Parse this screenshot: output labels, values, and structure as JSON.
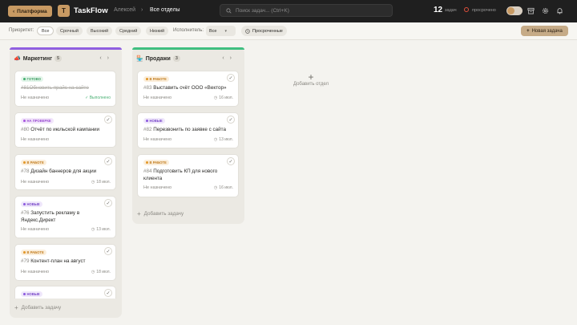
{
  "topbar": {
    "platform_label": "Платформа",
    "logo_letter": "T",
    "app_title": "TaskFlow",
    "user": "Алексей",
    "separator": "›",
    "current_view": "Все отделы",
    "search_placeholder": "Поиск задач... (Ctrl+K)",
    "tasks_count": "12",
    "tasks_label": "задач",
    "overdue_label": "просрочено"
  },
  "filters": {
    "priority_label": "Приоритет:",
    "priorities": [
      "Все",
      "Срочный",
      "Высокий",
      "Средний",
      "Низкий"
    ],
    "assignee_label": "Исполнитель:",
    "assignee_value": "Все",
    "overdue_chip": "Просроченные",
    "new_task_label": "Новая задача"
  },
  "columns": [
    {
      "name": "Маркетинг",
      "emoji": "📣",
      "count": "5",
      "bar_color": "#8f5fe0",
      "add_task_label": "Добавить задачу",
      "cards": [
        {
          "status": "ГОТОВО",
          "status_type": "done",
          "number": "#81",
          "title": "Обновить прайс на сайте",
          "assignee": "Не назначено",
          "date": "",
          "done_label": "✓ Выполнено",
          "strike": true
        },
        {
          "status": "НА ПРОВЕРКЕ",
          "status_type": "review",
          "number": "#80",
          "title": "Отчёт по июльской кампании",
          "assignee": "Не назначено",
          "date": ""
        },
        {
          "status": "В РАБОТЕ",
          "status_type": "work",
          "number": "#78",
          "title": "Дизайн баннеров для акции",
          "assignee": "Не назначено",
          "date": "18 июл."
        },
        {
          "status": "НОВЫЕ",
          "status_type": "new",
          "number": "#76",
          "title": "Запустить рекламу в Яндекс.Директ",
          "assignee": "Не назначено",
          "date": "13 июл."
        },
        {
          "status": "В РАБОТЕ",
          "status_type": "work",
          "number": "#79",
          "title": "Контент-план на август",
          "assignee": "Не назначено",
          "date": "18 июл."
        },
        {
          "status": "НОВЫЕ",
          "status_type": "new",
          "number": "",
          "title": "",
          "assignee": "",
          "date": ""
        }
      ]
    },
    {
      "name": "Продажи",
      "emoji": "🏪",
      "count": "3",
      "bar_color": "#3fbf80",
      "add_task_label": "Добавить задачу",
      "cards": [
        {
          "status": "В РАБОТЕ",
          "status_type": "work",
          "number": "#83",
          "title": "Выставить счёт ООО «Вектор»",
          "assignee": "Не назначено",
          "date": "16 июл."
        },
        {
          "status": "НОВЫЕ",
          "status_type": "new",
          "number": "#82",
          "title": "Перезвонить по заявке с сайта",
          "assignee": "Не назначено",
          "date": "13 июл."
        },
        {
          "status": "В РАБОТЕ",
          "status_type": "work",
          "number": "#84",
          "title": "Подготовить КП для нового клиента",
          "assignee": "Не назначено",
          "date": "16 июл."
        }
      ]
    }
  ],
  "add_department_label": "Добавить отдел"
}
